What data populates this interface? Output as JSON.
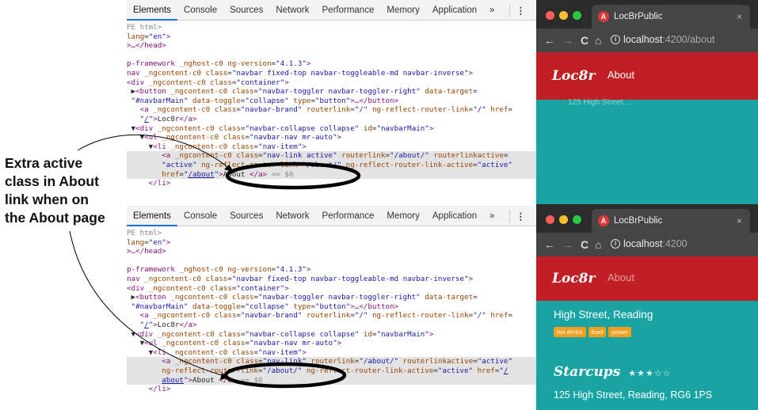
{
  "annotation": {
    "lines": [
      "Extra active",
      "class in About",
      "link when on",
      "the About page"
    ]
  },
  "devtools_tabs": [
    "Elements",
    "Console",
    "Sources",
    "Network",
    "Performance",
    "Memory",
    "Application",
    "»"
  ],
  "devtools_menu": "⋮",
  "devtools_top": {
    "lines": [
      {
        "html": "<span class='cm'>PE html></span>"
      },
      {
        "html": "<span class='an'>lang</span>=<span class='av'>\"en\"</span><span class='tg'>></span>"
      },
      {
        "html": "<span class='tg'>>…&lt;/head></span>"
      },
      {
        "html": ""
      },
      {
        "html": "<span class='tg'>p-framework</span> <span class='an'>_nghost-c0</span> <span class='an'>ng-version</span>=<span class='av'>\"4.1.3\"</span><span class='tg'>></span>"
      },
      {
        "html": "<span class='tg'>nav</span> <span class='an'>_ngcontent-c0</span> <span class='an'>class</span>=<span class='av'>\"navbar fixed-top navbar-toggleable-md navbar-inverse\"</span><span class='tg'>></span>"
      },
      {
        "html": "<span class='tg'>&lt;div</span> <span class='an'>_ngcontent-c0</span> <span class='an'>class</span>=<span class='av'>\"container\"</span><span class='tg'>></span>"
      },
      {
        "html": " ▶<span class='tg'>&lt;button</span> <span class='an'>_ngcontent-c0</span> <span class='an'>class</span>=<span class='av'>\"navbar-toggler navbar-toggler-right\"</span> <span class='an'>data-target</span>="
      },
      {
        "html": " <span class='av'>\"#navbarMain\"</span> <span class='an'>data-toggle</span>=<span class='av'>\"collapse\"</span> <span class='an'>type</span>=<span class='av'>\"button\"</span><span class='tg'>>…&lt;/button></span>"
      },
      {
        "html": "   <span class='tg'>&lt;a</span> <span class='an'>_ngcontent-c0</span> <span class='an'>class</span>=<span class='av'>\"navbar-brand\"</span> <span class='an'>routerlink</span>=<span class='av'>\"/\"</span> <span class='an'>ng-reflect-router-link</span>=<span class='av'>\"/\"</span> <span class='an'>href</span>="
      },
      {
        "html": "   <span class='av'>\"</span><span class='lk'>/</span><span class='av'>\"</span><span class='tg'>></span>Loc8r<span class='tg'>&lt;/a></span>"
      },
      {
        "html": " ▼<span class='tg'>&lt;div</span> <span class='an'>_ngcontent-c0</span> <span class='an'>class</span>=<span class='av'>\"navbar-collapse collapse\"</span> <span class='an'>id</span>=<span class='av'>\"navbarMain\"</span><span class='tg'>></span>"
      },
      {
        "html": "   ▼<span class='tg'>&lt;ul</span> <span class='an'>_ngcontent-c0</span> <span class='an'>class</span>=<span class='av'>\"navbar-nav mr-auto\"</span><span class='tg'>></span>"
      },
      {
        "html": "     ▼<span class='tg'>&lt;li</span> <span class='an'>_ngcontent-c0</span> <span class='an'>class</span>=<span class='av'>\"nav-item\"</span><span class='tg'>></span>"
      },
      {
        "hl": true,
        "html": "        <span class='tg'>&lt;a</span> <span class='an'>_ngcontent-c0</span> <span class='an'>class</span>=<span class='av'>\"nav-link active\"</span> <span class='an'>routerlink</span>=<span class='av'>\"/about/\"</span> <span class='an'>routerlinkactive</span>="
      },
      {
        "hl": true,
        "html": "        <span class='av'>\"active\"</span> <span class='an'>ng-reflect-router-link</span>=<span class='av'>\"/about/\"</span> <span class='an'>ng-reflect-router-link-active</span>=<span class='av'>\"active\"</span>"
      },
      {
        "hl": true,
        "html": "        <span class='an'>href</span>=<span class='av'>\"</span><span class='lk'>/about</span><span class='av'>\"</span><span class='tg'>></span>About <span class='tg'>&lt;/a></span> <span class='cm'>== $0</span>"
      },
      {
        "html": "     <span class='tg'>&lt;/li></span>"
      }
    ]
  },
  "devtools_bottom": {
    "lines": [
      {
        "html": "<span class='cm'>PE html></span>"
      },
      {
        "html": "<span class='an'>lang</span>=<span class='av'>\"en\"</span><span class='tg'>></span>"
      },
      {
        "html": "<span class='tg'>>…&lt;/head></span>"
      },
      {
        "html": ""
      },
      {
        "html": "<span class='tg'>p-framework</span> <span class='an'>_nghost-c0</span> <span class='an'>ng-version</span>=<span class='av'>\"4.1.3\"</span><span class='tg'>></span>"
      },
      {
        "html": "<span class='tg'>nav</span> <span class='an'>_ngcontent-c0</span> <span class='an'>class</span>=<span class='av'>\"navbar fixed-top navbar-toggleable-md navbar-inverse\"</span><span class='tg'>></span>"
      },
      {
        "html": "<span class='tg'>&lt;div</span> <span class='an'>_ngcontent-c0</span> <span class='an'>class</span>=<span class='av'>\"container\"</span><span class='tg'>></span>"
      },
      {
        "html": " ▶<span class='tg'>&lt;button</span> <span class='an'>_ngcontent-c0</span> <span class='an'>class</span>=<span class='av'>\"navbar-toggler navbar-toggler-right\"</span> <span class='an'>data-target</span>="
      },
      {
        "html": " <span class='av'>\"#navbarMain\"</span> <span class='an'>data-toggle</span>=<span class='av'>\"collapse\"</span> <span class='an'>type</span>=<span class='av'>\"button\"</span><span class='tg'>>…&lt;/button></span>"
      },
      {
        "html": "   <span class='tg'>&lt;a</span> <span class='an'>_ngcontent-c0</span> <span class='an'>class</span>=<span class='av'>\"navbar-brand\"</span> <span class='an'>routerlink</span>=<span class='av'>\"/\"</span> <span class='an'>ng-reflect-router-link</span>=<span class='av'>\"/\"</span> <span class='an'>href</span>="
      },
      {
        "html": "   <span class='av'>\"</span><span class='lk'>/</span><span class='av'>\"</span><span class='tg'>></span>Loc8r<span class='tg'>&lt;/a></span>"
      },
      {
        "html": " ▼<span class='tg'>&lt;div</span> <span class='an'>_ngcontent-c0</span> <span class='an'>class</span>=<span class='av'>\"navbar-collapse collapse\"</span> <span class='an'>id</span>=<span class='av'>\"navbarMain\"</span><span class='tg'>></span>"
      },
      {
        "html": "   ▼<span class='tg'>&lt;ul</span> <span class='an'>_ngcontent-c0</span> <span class='an'>class</span>=<span class='av'>\"navbar-nav mr-auto\"</span><span class='tg'>></span>"
      },
      {
        "html": "     ▼<span class='tg'>&lt;li</span> <span class='an'>_ngcontent-c0</span> <span class='an'>class</span>=<span class='av'>\"nav-item\"</span><span class='tg'>></span>"
      },
      {
        "hl": true,
        "html": "        <span class='tg'>&lt;a</span> <span class='an'>_ngcontent-c0</span> <span class='an'>class</span>=<span class='av'>\"nav-link\"</span> <span class='an'>routerlink</span>=<span class='av'>\"/about/\"</span> <span class='an'>routerlinkactive</span>=<span class='av'>\"active\"</span>"
      },
      {
        "hl": true,
        "html": "        <span class='an'>ng-reflect-router-link</span>=<span class='av'>\"/about/\"</span> <span class='an'>ng-reflect-router-link-active</span>=<span class='av'>\"active\"</span> <span class='an'>href</span>=<span class='av'>\"</span><span class='lk'>/</span>"
      },
      {
        "hl": true,
        "html": "        <span class='lk'>about</span><span class='av'>\"</span><span class='tg'>></span>About <span class='tg'>&lt;/a></span> <span class='cm'>== $0</span>"
      },
      {
        "html": "     <span class='tg'>&lt;/li></span>"
      }
    ]
  },
  "browser_top": {
    "tab_title": "LocBrPublic",
    "tab_icon": "A",
    "tab_close": "×",
    "url_host": "localhost",
    "url_path": ":4200/about",
    "brand": "Loc8r",
    "nav_link": "About",
    "peek_text": "125 High Street, ..."
  },
  "browser_bottom": {
    "tab_title": "LocBrPublic",
    "tab_icon": "A",
    "tab_close": "×",
    "url_host": "localhost",
    "url_path": ":4200",
    "brand": "Loc8r",
    "nav_link": "About",
    "location1_address": "High Street, Reading",
    "badges": [
      "hot drinks",
      "food",
      "power"
    ],
    "location2_name": "Starcups",
    "location2_stars": "★★★☆☆",
    "location2_address": "125 High Street, Reading, RG6 1PS"
  },
  "icons": {
    "back": "←",
    "forward": "→",
    "reload": "C",
    "home": "⌂",
    "info": "i"
  },
  "colors": {
    "navbar_red": "#c01f25",
    "teal": "#1aa3a3",
    "badge_orange": "#f29f1f"
  }
}
